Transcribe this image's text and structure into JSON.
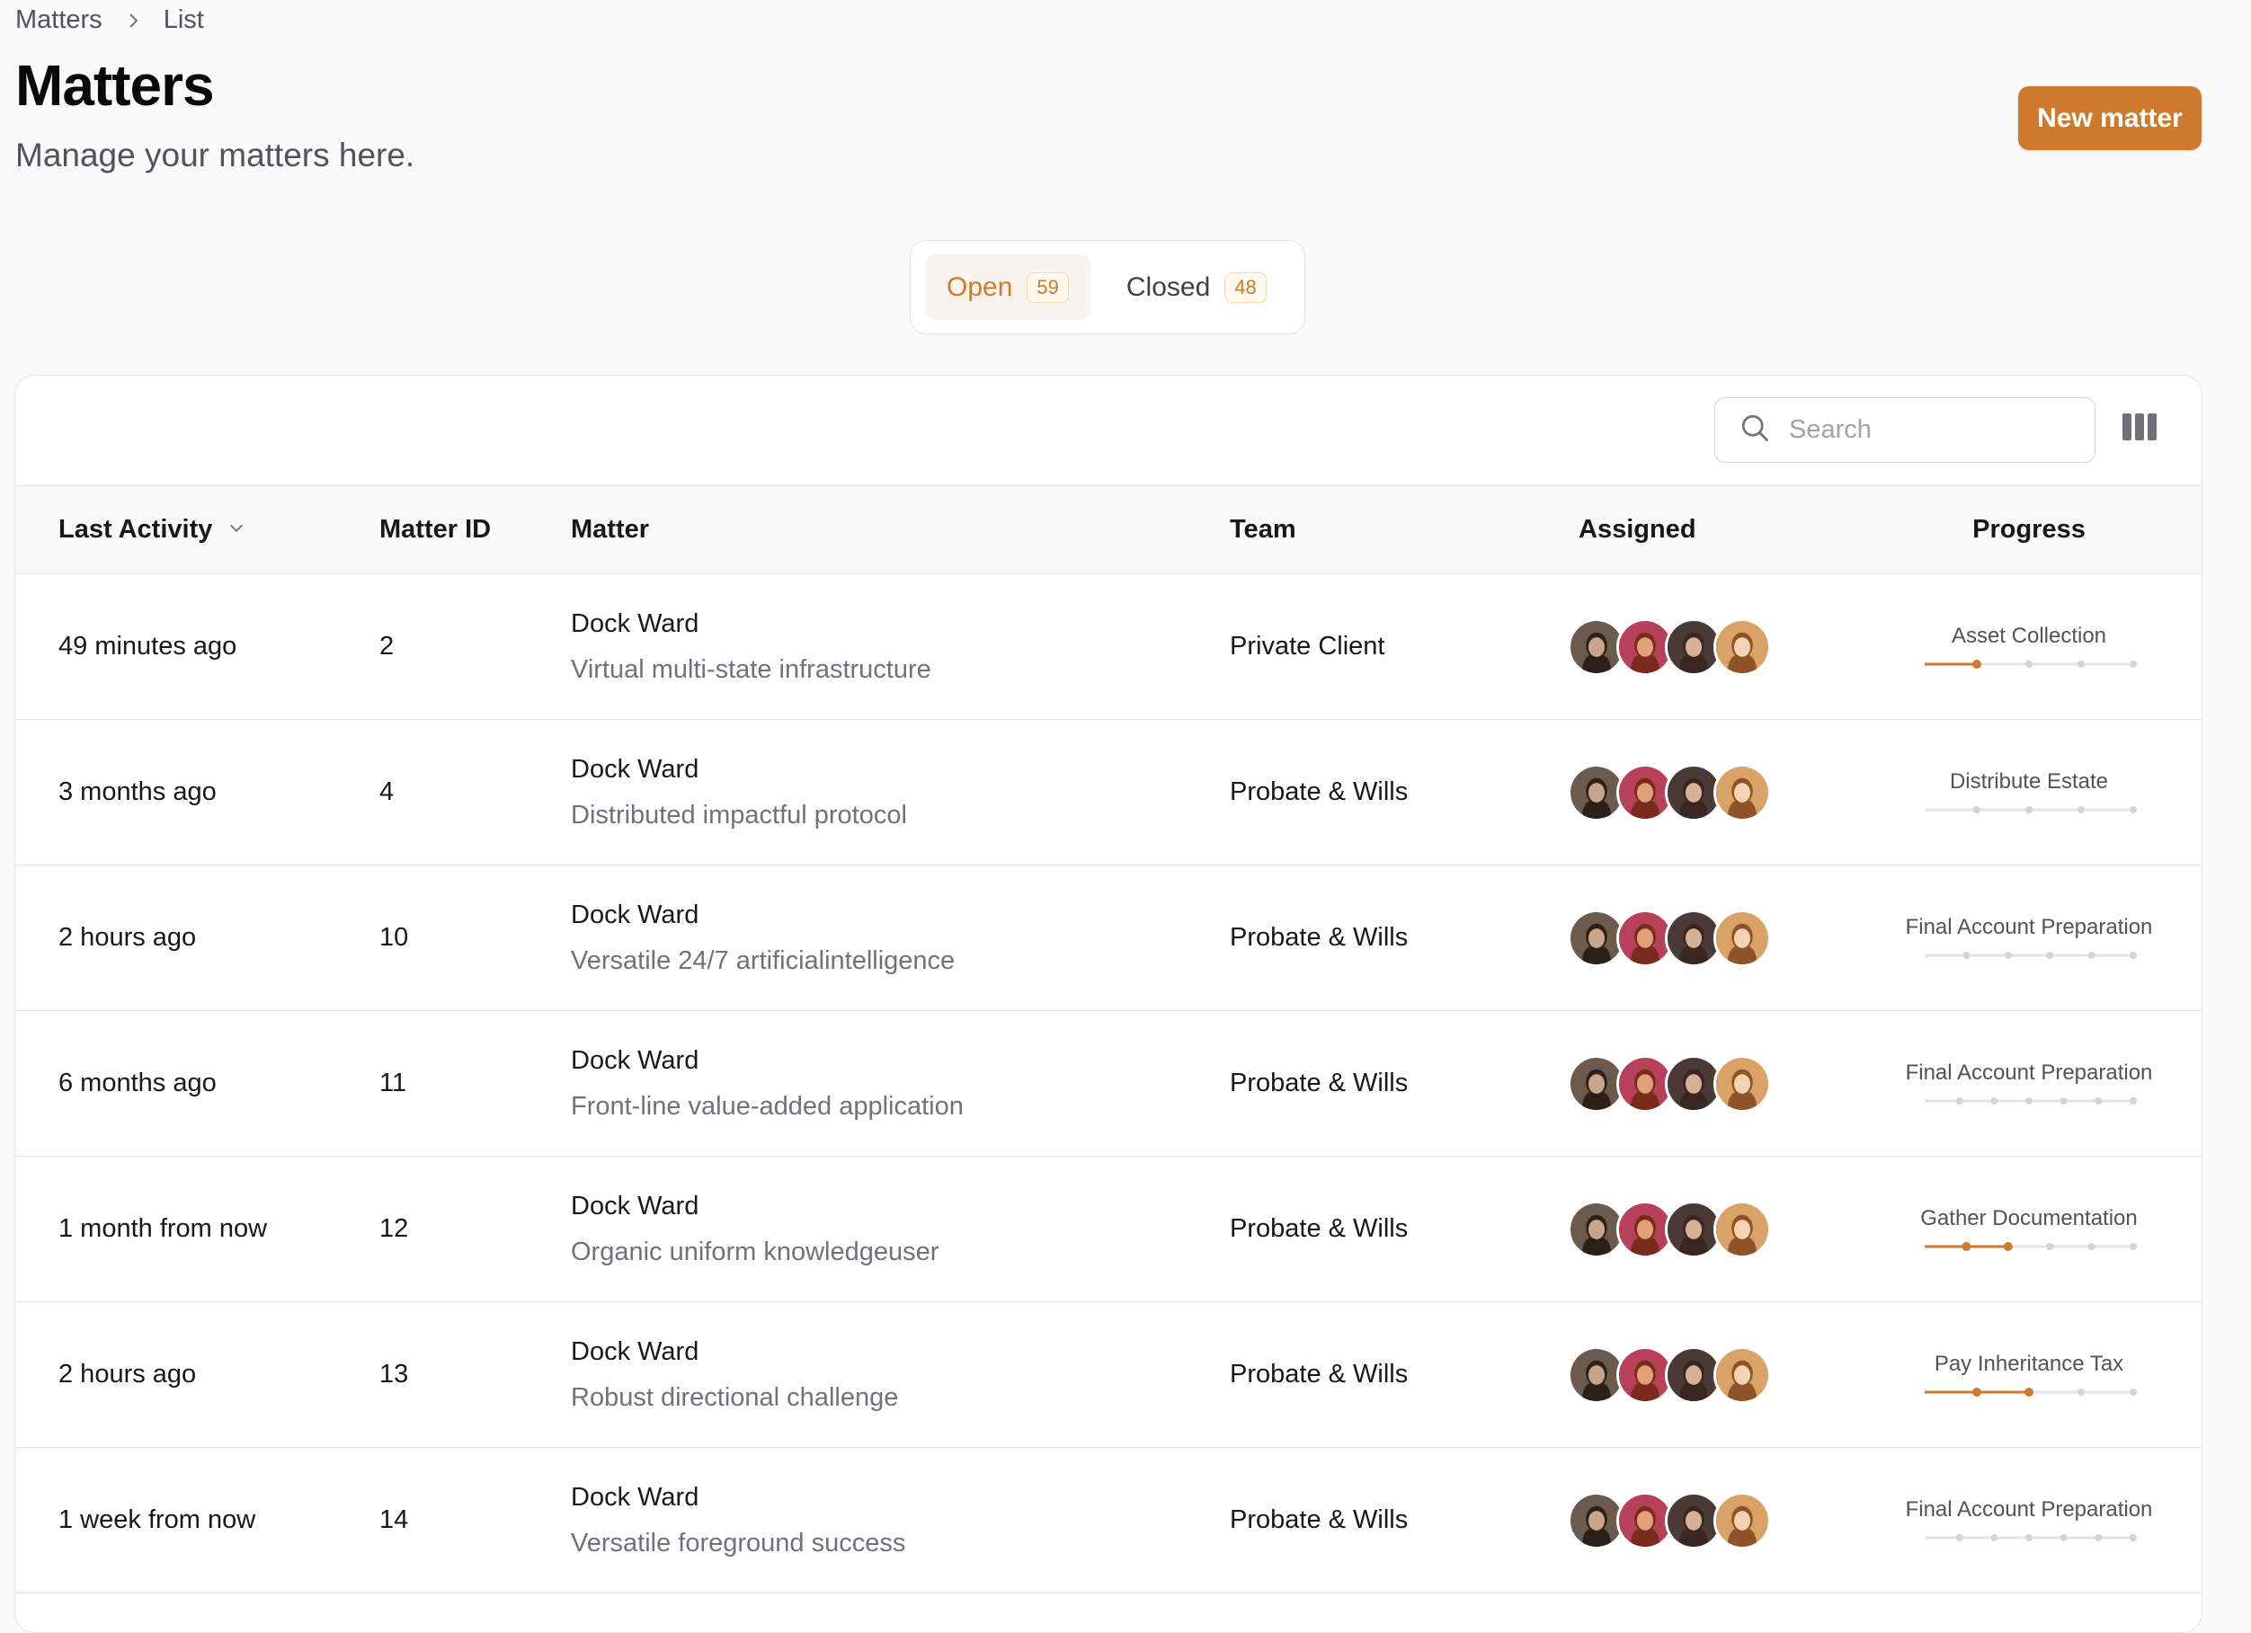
{
  "breadcrumb": {
    "root": "Matters",
    "current": "List"
  },
  "page": {
    "title": "Matters",
    "subtitle": "Manage your matters here.",
    "new_button": "New matter"
  },
  "tabs": [
    {
      "label": "Open",
      "count": "59",
      "active": true
    },
    {
      "label": "Closed",
      "count": "48",
      "active": false
    }
  ],
  "search": {
    "placeholder": "Search",
    "value": ""
  },
  "table": {
    "headers": {
      "last_activity": "Last Activity",
      "matter_id": "Matter ID",
      "matter": "Matter",
      "team": "Team",
      "assigned": "Assigned",
      "progress": "Progress"
    },
    "rows": [
      {
        "last_activity": "49 minutes ago",
        "matter_id": "2",
        "matter_name": "Dock Ward",
        "matter_desc": "Virtual multi-state infrastructure",
        "team": "Private Client",
        "progress_label": "Asset Collection",
        "progress_steps": 4,
        "progress_done": 1
      },
      {
        "last_activity": "3 months ago",
        "matter_id": "4",
        "matter_name": "Dock Ward",
        "matter_desc": "Distributed impactful protocol",
        "team": "Probate & Wills",
        "progress_label": "Distribute Estate",
        "progress_steps": 4,
        "progress_done": 0
      },
      {
        "last_activity": "2 hours ago",
        "matter_id": "10",
        "matter_name": "Dock Ward",
        "matter_desc": "Versatile 24/7 artificialintelligence",
        "team": "Probate & Wills",
        "progress_label": "Final Account Preparation",
        "progress_steps": 5,
        "progress_done": 0
      },
      {
        "last_activity": "6 months ago",
        "matter_id": "11",
        "matter_name": "Dock Ward",
        "matter_desc": "Front-line value-added application",
        "team": "Probate & Wills",
        "progress_label": "Final Account Preparation",
        "progress_steps": 6,
        "progress_done": 0
      },
      {
        "last_activity": "1 month from now",
        "matter_id": "12",
        "matter_name": "Dock Ward",
        "matter_desc": "Organic uniform knowledgeuser",
        "team": "Probate & Wills",
        "progress_label": "Gather Documentation",
        "progress_steps": 5,
        "progress_done": 2
      },
      {
        "last_activity": "2 hours ago",
        "matter_id": "13",
        "matter_name": "Dock Ward",
        "matter_desc": "Robust directional challenge",
        "team": "Probate & Wills",
        "progress_label": "Pay Inheritance Tax",
        "progress_steps": 4,
        "progress_done": 2
      },
      {
        "last_activity": "1 week from now",
        "matter_id": "14",
        "matter_name": "Dock Ward",
        "matter_desc": "Versatile foreground success",
        "team": "Probate & Wills",
        "progress_label": "Final Account Preparation",
        "progress_steps": 6,
        "progress_done": 0
      }
    ]
  },
  "avatars": [
    {
      "name": "avatar-1",
      "bg": "#6b5a4e",
      "skin": "#c9a58a",
      "hair": "#2b2119"
    },
    {
      "name": "avatar-2",
      "bg": "#b7405a",
      "skin": "#e0a07a",
      "hair": "#7a2b1c"
    },
    {
      "name": "avatar-3",
      "bg": "#4a3a36",
      "skin": "#d8b095",
      "hair": "#3a2620"
    },
    {
      "name": "avatar-4",
      "bg": "#d9a368",
      "skin": "#f2d3b4",
      "hair": "#8f5327"
    }
  ],
  "colors": {
    "accent": "#cd7a2d",
    "track": "#e4e4e7",
    "dot_inactive": "#d4d4d8"
  }
}
